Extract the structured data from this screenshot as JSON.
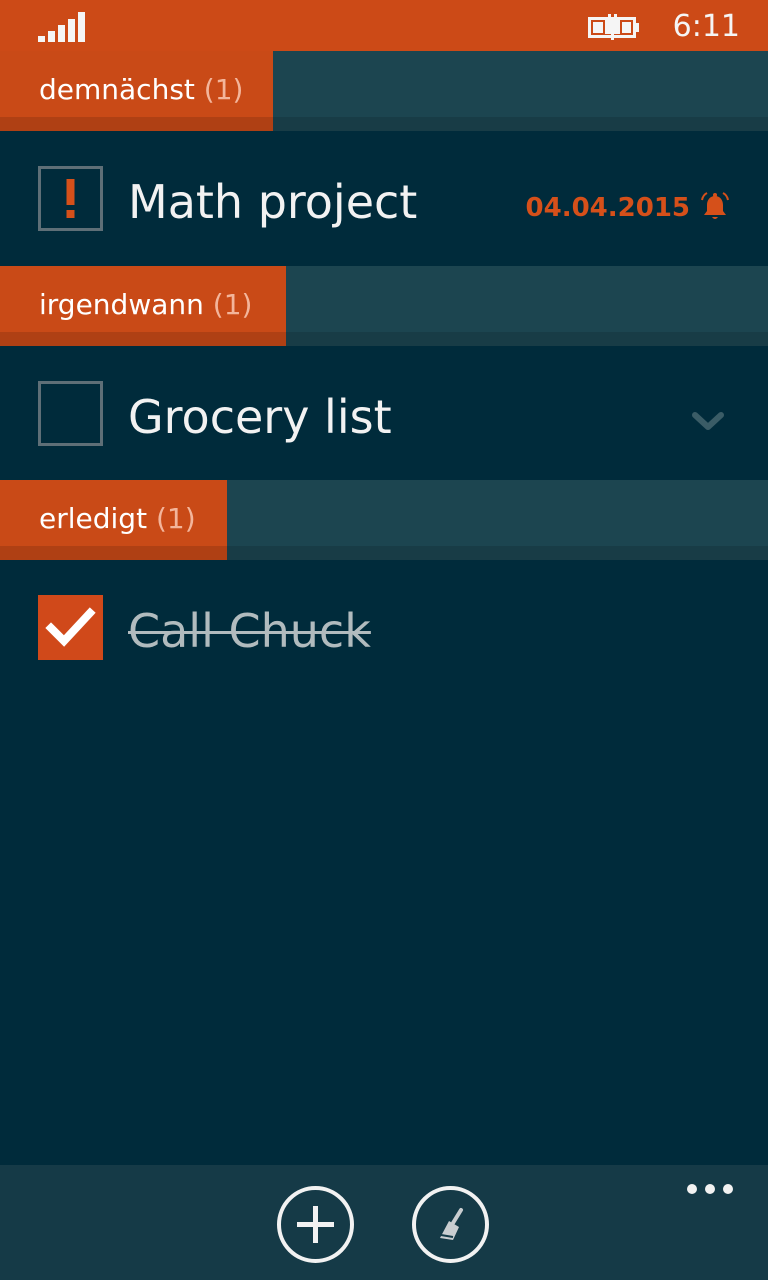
{
  "status_bar": {
    "time": "6:11",
    "accent_color": "#CC4A17",
    "signal_icon": "signal-strength-icon",
    "battery_icon": "battery-charging-icon"
  },
  "sections": [
    {
      "label": "demnächst",
      "count": "(1)",
      "tasks": [
        {
          "title": "Math project",
          "checkbox_state": "important",
          "due_date": "04.04.2015",
          "alarm_icon": "alarm-bell-icon"
        }
      ]
    },
    {
      "label": "irgendwann",
      "count": "(1)",
      "tasks": [
        {
          "title": "Grocery list",
          "checkbox_state": "unchecked",
          "expand_icon": "chevron-down-icon"
        }
      ]
    },
    {
      "label": "erledigt",
      "count": "(1)",
      "tasks": [
        {
          "title": "Call Chuck",
          "checkbox_state": "checked"
        }
      ]
    }
  ],
  "app_bar": {
    "buttons": [
      {
        "icon": "add-icon"
      },
      {
        "icon": "broom-clean-icon"
      }
    ],
    "more_icon": "more-dots-icon"
  },
  "colors": {
    "background": "#002B3B",
    "accent": "#CC4A17",
    "section_strip": "#1C4550",
    "app_bar": "#153A47"
  }
}
